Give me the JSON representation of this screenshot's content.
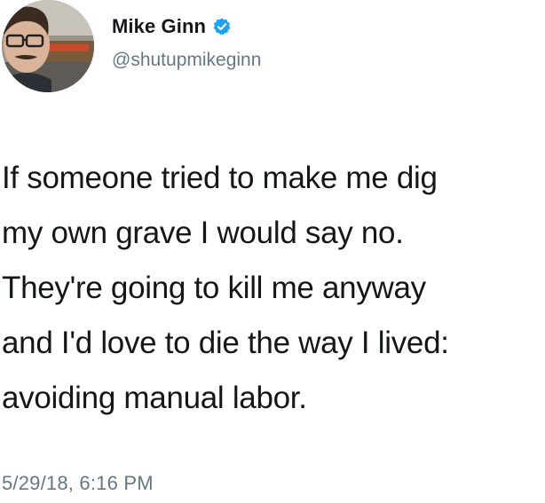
{
  "author": {
    "display_name": "Mike Ginn",
    "handle": "@shutupmikeginn",
    "verified": true,
    "avatar_icon": "profile-photo"
  },
  "tweet": {
    "lines": [
      "If someone tried to make me dig",
      "my own grave I would say no.",
      "They're going to kill me anyway",
      "and I'd love to die the way I lived:",
      "avoiding manual labor."
    ],
    "timestamp": "5/29/18, 6:16 PM"
  },
  "colors": {
    "text": "#14171a",
    "secondary_text": "#657786",
    "verified_badge": "#1da1f2",
    "background": "#ffffff"
  }
}
